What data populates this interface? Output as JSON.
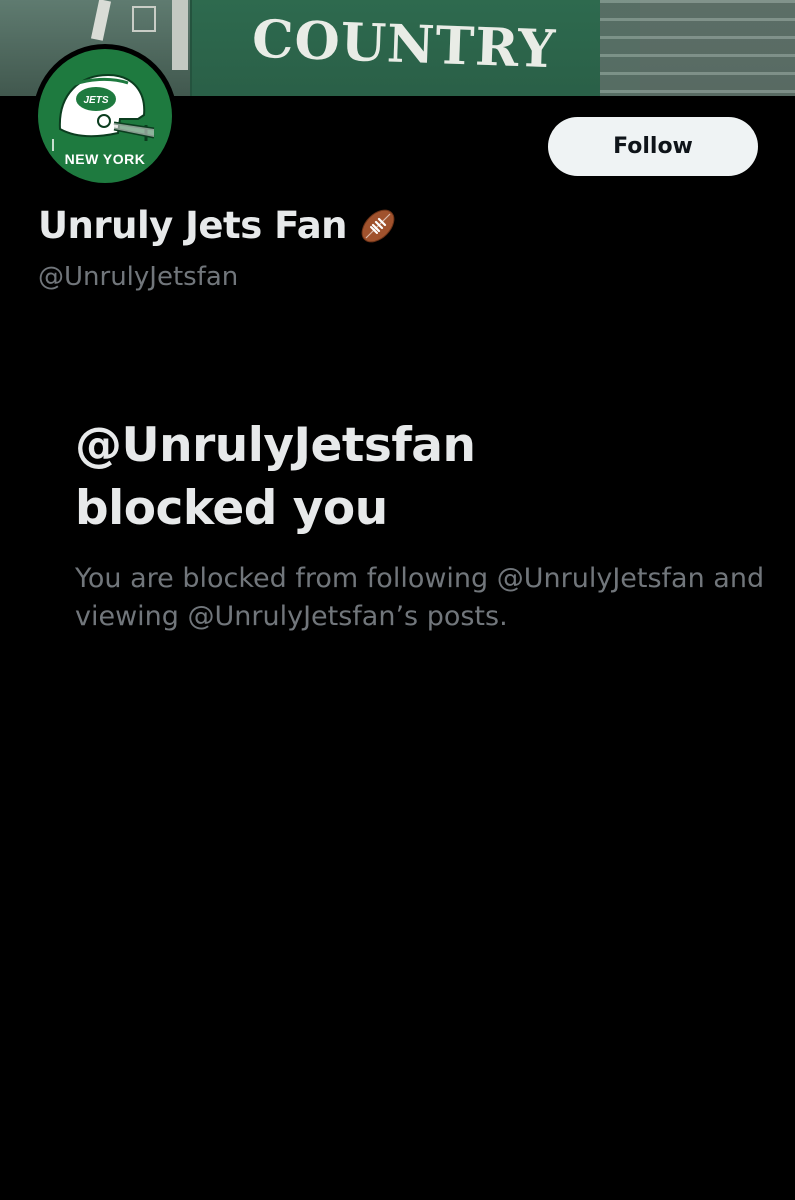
{
  "banner": {
    "text": "COUNTRY"
  },
  "avatar": {
    "caption": "NEW YORK",
    "badge": "JETS",
    "colors": {
      "background": "#1e7a3f",
      "helmet": "#ffffff"
    }
  },
  "actions": {
    "follow_label": "Follow"
  },
  "profile": {
    "display_name": "Unruly Jets Fan",
    "handle": "@UnrulyJetsfan",
    "emoji_icon": "football-icon"
  },
  "blocked": {
    "title_line1": "@UnrulyJetsfan",
    "title_line2": "blocked you",
    "description": "You are blocked from following @UnrulyJetsfan and viewing @UnrulyJetsfan’s posts."
  },
  "colors": {
    "background": "#000000",
    "primary_text": "#e7e9ea",
    "secondary_text": "#71767b",
    "button_bg": "#eff3f4"
  }
}
